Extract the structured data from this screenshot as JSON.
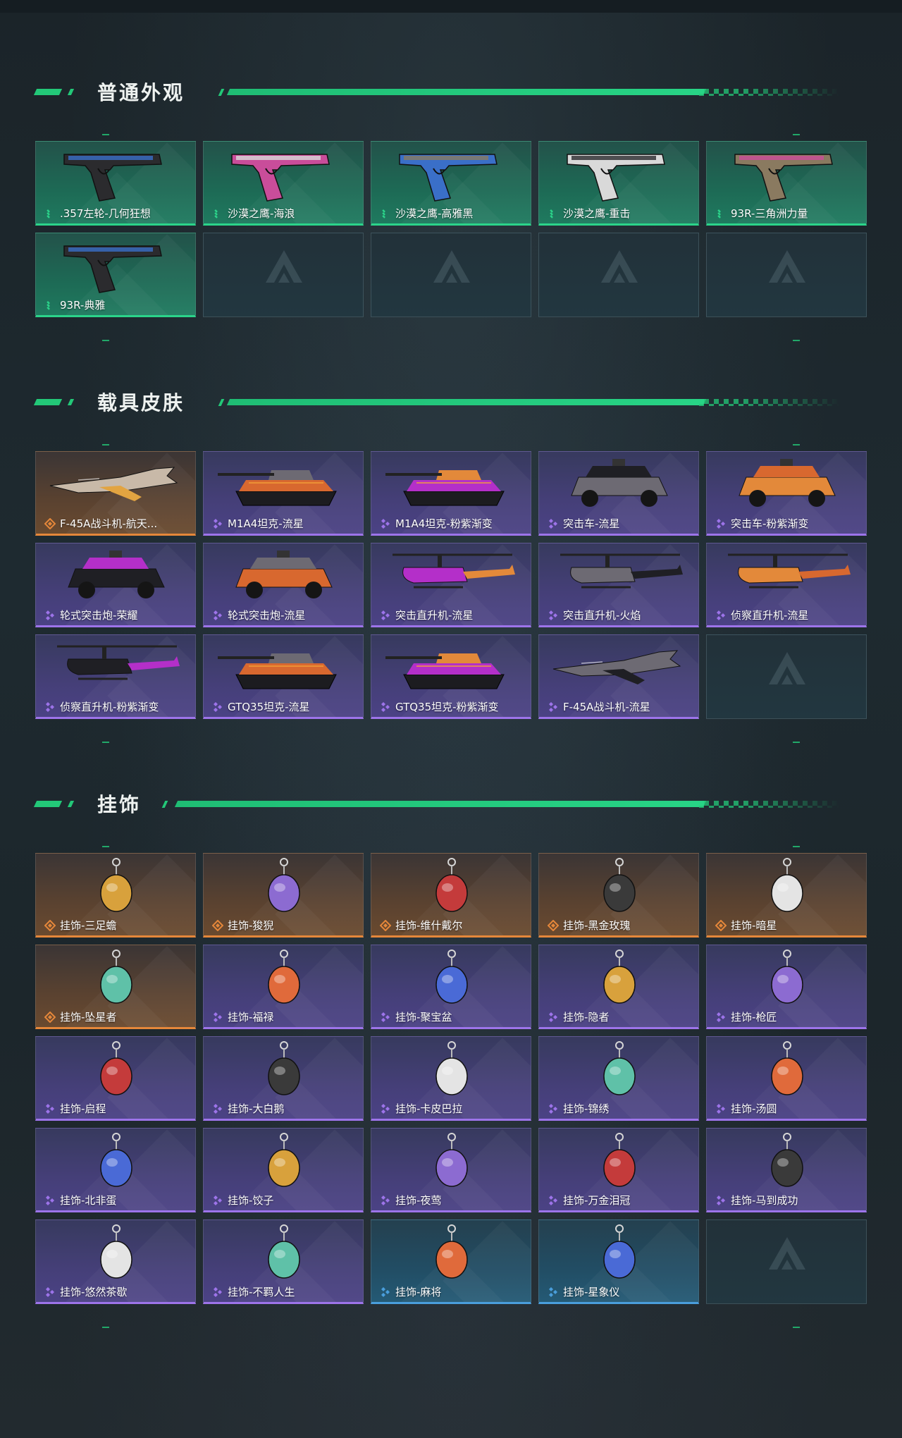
{
  "colors": {
    "accent": "#23c878",
    "green_rarity": "#2bd48a",
    "orange_rarity": "#e5873a",
    "purple_rarity": "#9d74ea",
    "blue_rarity": "#4a9edc"
  },
  "sections": [
    {
      "title": "普通外观",
      "items": [
        {
          "name": ".357左轮-几何狂想",
          "rarity": "green",
          "icon": "revolver-icon"
        },
        {
          "name": "沙漠之鹰-海浪",
          "rarity": "green",
          "icon": "pistol-icon"
        },
        {
          "name": "沙漠之鹰-高雅黑",
          "rarity": "green",
          "icon": "pistol-icon"
        },
        {
          "name": "沙漠之鹰-重击",
          "rarity": "green",
          "icon": "pistol-icon"
        },
        {
          "name": "93R-三角洲力量",
          "rarity": "green",
          "icon": "pistol-icon"
        },
        {
          "name": "93R-典雅",
          "rarity": "green",
          "icon": "pistol-icon"
        }
      ]
    },
    {
      "title": "载具皮肤",
      "items": [
        {
          "name": "F-45A战斗机-航天...",
          "rarity": "orange",
          "icon": "jet-icon"
        },
        {
          "name": "M1A4坦克-流星",
          "rarity": "purple",
          "icon": "tank-icon"
        },
        {
          "name": "M1A4坦克-粉紫渐变",
          "rarity": "purple",
          "icon": "tank-icon"
        },
        {
          "name": "突击车-流星",
          "rarity": "purple",
          "icon": "truck-icon"
        },
        {
          "name": "突击车-粉紫渐变",
          "rarity": "purple",
          "icon": "truck-icon"
        },
        {
          "name": "轮式突击炮-荣耀",
          "rarity": "purple",
          "icon": "armored-car-icon"
        },
        {
          "name": "轮式突击炮-流星",
          "rarity": "purple",
          "icon": "armored-car-icon"
        },
        {
          "name": "突击直升机-流星",
          "rarity": "purple",
          "icon": "helicopter-icon"
        },
        {
          "name": "突击直升机-火焰",
          "rarity": "purple",
          "icon": "helicopter-icon"
        },
        {
          "name": "侦察直升机-流星",
          "rarity": "purple",
          "icon": "helicopter-icon"
        },
        {
          "name": "侦察直升机-粉紫渐变",
          "rarity": "purple",
          "icon": "helicopter-icon"
        },
        {
          "name": "GTQ35坦克-流星",
          "rarity": "purple",
          "icon": "tank-icon"
        },
        {
          "name": "GTQ35坦克-粉紫渐变",
          "rarity": "purple",
          "icon": "tank-icon"
        },
        {
          "name": "F-45A战斗机-流星",
          "rarity": "purple",
          "icon": "jet-icon"
        }
      ]
    },
    {
      "title": "挂饰",
      "items": [
        {
          "name": "挂饰-三足蟾",
          "rarity": "orange",
          "icon": "charm-icon"
        },
        {
          "name": "挂饰-狻猊",
          "rarity": "orange",
          "icon": "charm-icon"
        },
        {
          "name": "挂饰-维什戴尔",
          "rarity": "orange",
          "icon": "charm-icon"
        },
        {
          "name": "挂饰-黑金玫瑰",
          "rarity": "orange",
          "icon": "charm-icon"
        },
        {
          "name": "挂饰-暗星",
          "rarity": "orange",
          "icon": "charm-icon"
        },
        {
          "name": "挂饰-坠星者",
          "rarity": "orange",
          "icon": "charm-icon"
        },
        {
          "name": "挂饰-福禄",
          "rarity": "purple",
          "icon": "charm-icon"
        },
        {
          "name": "挂饰-聚宝盆",
          "rarity": "purple",
          "icon": "charm-icon"
        },
        {
          "name": "挂饰-隐者",
          "rarity": "purple",
          "icon": "charm-icon"
        },
        {
          "name": "挂饰-枪匠",
          "rarity": "purple",
          "icon": "charm-icon"
        },
        {
          "name": "挂饰-启程",
          "rarity": "purple",
          "icon": "charm-icon"
        },
        {
          "name": "挂饰-大白鹅",
          "rarity": "purple",
          "icon": "charm-icon"
        },
        {
          "name": "挂饰-卡皮巴拉",
          "rarity": "purple",
          "icon": "charm-icon"
        },
        {
          "name": "挂饰-锦绣",
          "rarity": "purple",
          "icon": "charm-icon"
        },
        {
          "name": "挂饰-汤圆",
          "rarity": "purple",
          "icon": "charm-icon"
        },
        {
          "name": "挂饰-北非蛋",
          "rarity": "purple",
          "icon": "charm-icon"
        },
        {
          "name": "挂饰-饺子",
          "rarity": "purple",
          "icon": "charm-icon"
        },
        {
          "name": "挂饰-夜莺",
          "rarity": "purple",
          "icon": "charm-icon"
        },
        {
          "name": "挂饰-万金泪冠",
          "rarity": "purple",
          "icon": "charm-icon"
        },
        {
          "name": "挂饰-马到成功",
          "rarity": "purple",
          "icon": "charm-icon"
        },
        {
          "name": "挂饰-悠然茶歇",
          "rarity": "purple",
          "icon": "charm-icon"
        },
        {
          "name": "挂饰-不羁人生",
          "rarity": "purple",
          "icon": "charm-icon"
        },
        {
          "name": "挂饰-麻将",
          "rarity": "blue",
          "icon": "charm-icon"
        },
        {
          "name": "挂饰-星象仪",
          "rarity": "blue",
          "icon": "charm-icon"
        }
      ]
    }
  ]
}
